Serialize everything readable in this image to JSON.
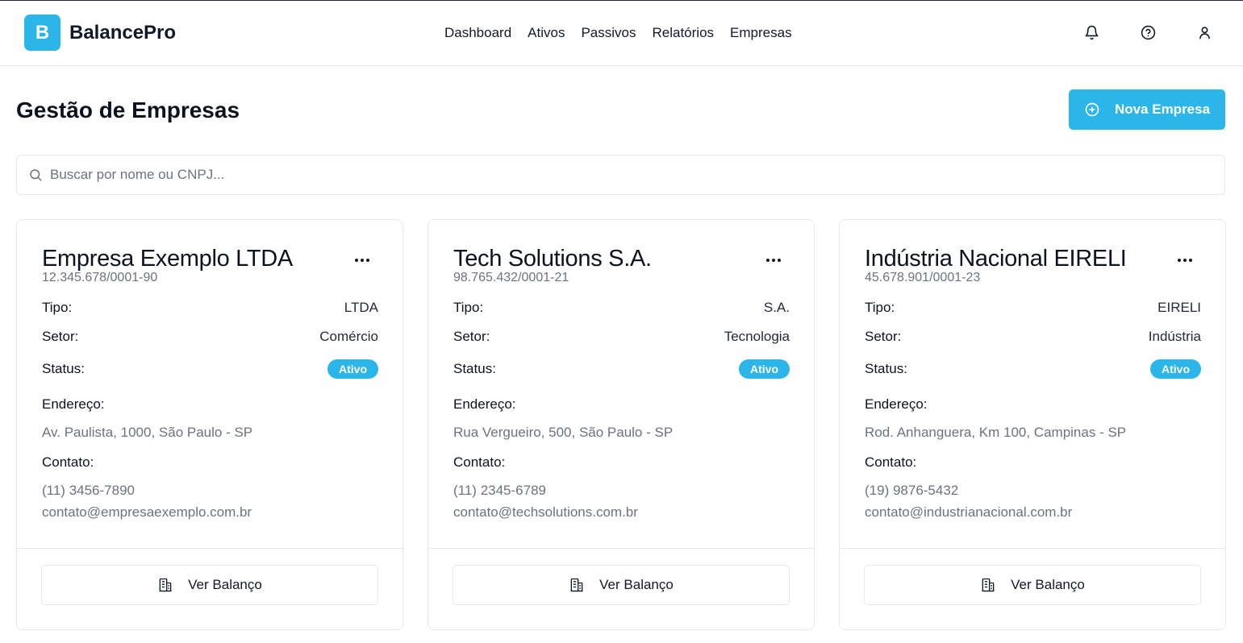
{
  "app": {
    "logo_letter": "B",
    "name": "BalancePro"
  },
  "nav": [
    "Dashboard",
    "Ativos",
    "Passivos",
    "Relatórios",
    "Empresas"
  ],
  "icons": {
    "notifications": "bell-icon",
    "help": "help-circle-icon",
    "user": "user-icon"
  },
  "page": {
    "title": "Gestão de Empresas",
    "new_button": "Nova Empresa"
  },
  "search": {
    "placeholder": "Buscar por nome ou CNPJ..."
  },
  "labels": {
    "tipo": "Tipo:",
    "setor": "Setor:",
    "status": "Status:",
    "endereco": "Endereço:",
    "contato": "Contato:",
    "menu": "...",
    "ver_balanco": "Ver Balanço"
  },
  "colors": {
    "accent": "#2bb5e8"
  },
  "companies": [
    {
      "name": "Empresa Exemplo LTDA",
      "cnpj": "12.345.678/0001-90",
      "tipo": "LTDA",
      "setor": "Comércio",
      "status": "Ativo",
      "endereco": "Av. Paulista, 1000, São Paulo - SP",
      "telefone": "(11) 3456-7890",
      "email": "contato@empresaexemplo.com.br"
    },
    {
      "name": "Tech Solutions S.A.",
      "cnpj": "98.765.432/0001-21",
      "tipo": "S.A.",
      "setor": "Tecnologia",
      "status": "Ativo",
      "endereco": "Rua Vergueiro, 500, São Paulo - SP",
      "telefone": "(11) 2345-6789",
      "email": "contato@techsolutions.com.br"
    },
    {
      "name": "Indústria Nacional EIRELI",
      "cnpj": "45.678.901/0001-23",
      "tipo": "EIRELI",
      "setor": "Indústria",
      "status": "Ativo",
      "endereco": "Rod. Anhanguera, Km 100, Campinas - SP",
      "telefone": "(19) 9876-5432",
      "email": "contato@industrianacional.com.br"
    }
  ]
}
